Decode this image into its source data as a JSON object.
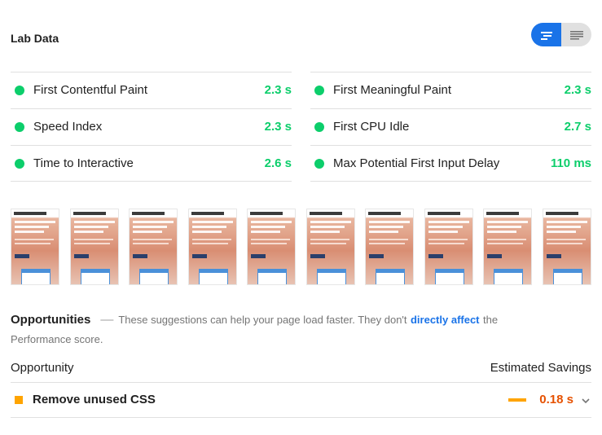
{
  "lab": {
    "title": "Lab Data",
    "toggle": {
      "active_icon": "bar-chart-icon",
      "inactive_icon": "list-icon"
    }
  },
  "metrics": {
    "left": [
      {
        "label": "First Contentful Paint",
        "value": "2.3 s",
        "status": "good"
      },
      {
        "label": "Speed Index",
        "value": "2.3 s",
        "status": "good"
      },
      {
        "label": "Time to Interactive",
        "value": "2.6 s",
        "status": "good"
      }
    ],
    "right": [
      {
        "label": "First Meaningful Paint",
        "value": "2.3 s",
        "status": "good"
      },
      {
        "label": "First CPU Idle",
        "value": "2.7 s",
        "status": "good"
      },
      {
        "label": "Max Potential First Input Delay",
        "value": "110 ms",
        "status": "good"
      }
    ]
  },
  "filmstrip": {
    "frame_count": 10
  },
  "opportunities": {
    "title": "Opportunities",
    "dash": "—",
    "desc_before": "These suggestions can help your page load faster. They don't",
    "link": "directly affect",
    "desc_after": "the Performance score.",
    "col_opportunity": "Opportunity",
    "col_savings": "Estimated Savings",
    "items": [
      {
        "label": "Remove unused CSS",
        "savings": "0.18 s",
        "severity": "average"
      }
    ]
  },
  "colors": {
    "good": "#0cce6b",
    "average": "#ffa400",
    "average_text": "#e65100",
    "accent": "#1a73e8"
  }
}
